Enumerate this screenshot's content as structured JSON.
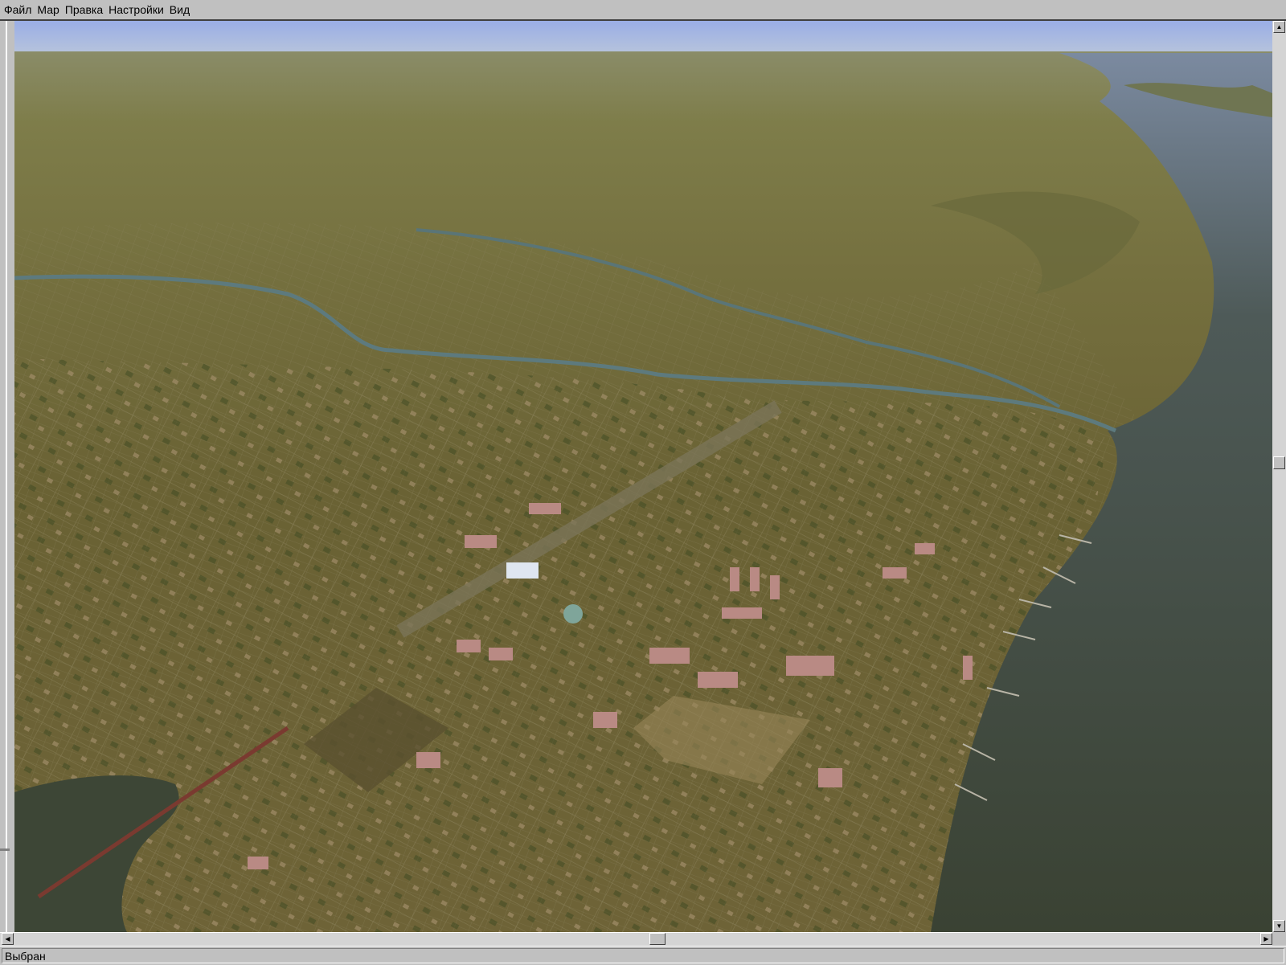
{
  "menu": {
    "items": [
      "Файл",
      "Мар",
      "Правка",
      "Настройки",
      "Вид"
    ]
  },
  "scrollbars": {
    "vertical_position_percent": 49,
    "horizontal_position_percent": 52,
    "up_icon": "triangle-up-icon",
    "down_icon": "triangle-down-icon",
    "left_icon": "triangle-left-icon",
    "right_icon": "triangle-right-icon"
  },
  "status": {
    "text": "Выбран"
  },
  "colors": {
    "sky": "#9fb2e6",
    "steppe": "#7b7a45",
    "city": "#6b6334",
    "river": "#3d4535",
    "chrome": "#c0c0c0"
  }
}
